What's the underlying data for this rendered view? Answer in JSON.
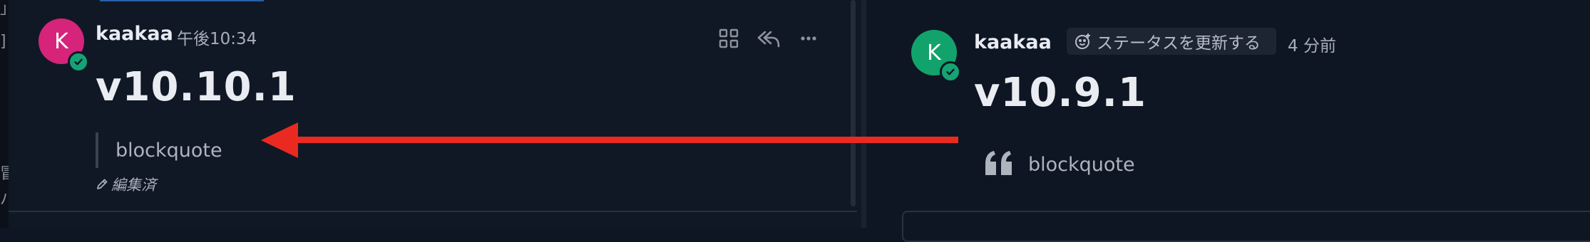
{
  "left_message": {
    "avatar_letter": "K",
    "author": "kaakaa",
    "timestamp": "午後10:34",
    "heading": "v10.10.1",
    "blockquote": "blockquote",
    "edited_label": "編集済",
    "actions": [
      "grid-icon",
      "reply-icon",
      "more-icon"
    ]
  },
  "right_message": {
    "avatar_letter": "K",
    "author": "kaakaa",
    "status_button": "ステータスを更新する",
    "timestamp": "4 分前",
    "heading": "v10.9.1",
    "blockquote": "blockquote"
  },
  "edge_glyphs": [
    "」",
    "]",
    "冒",
    "バ"
  ],
  "colors": {
    "left_avatar": "#d6247a",
    "right_avatar": "#11a36b",
    "badge": "#16a374",
    "arrow": "#ea2a20",
    "background": "#101826"
  },
  "annotation": {
    "type": "arrow",
    "direction": "right-to-left",
    "icon": "arrow-left-icon"
  }
}
